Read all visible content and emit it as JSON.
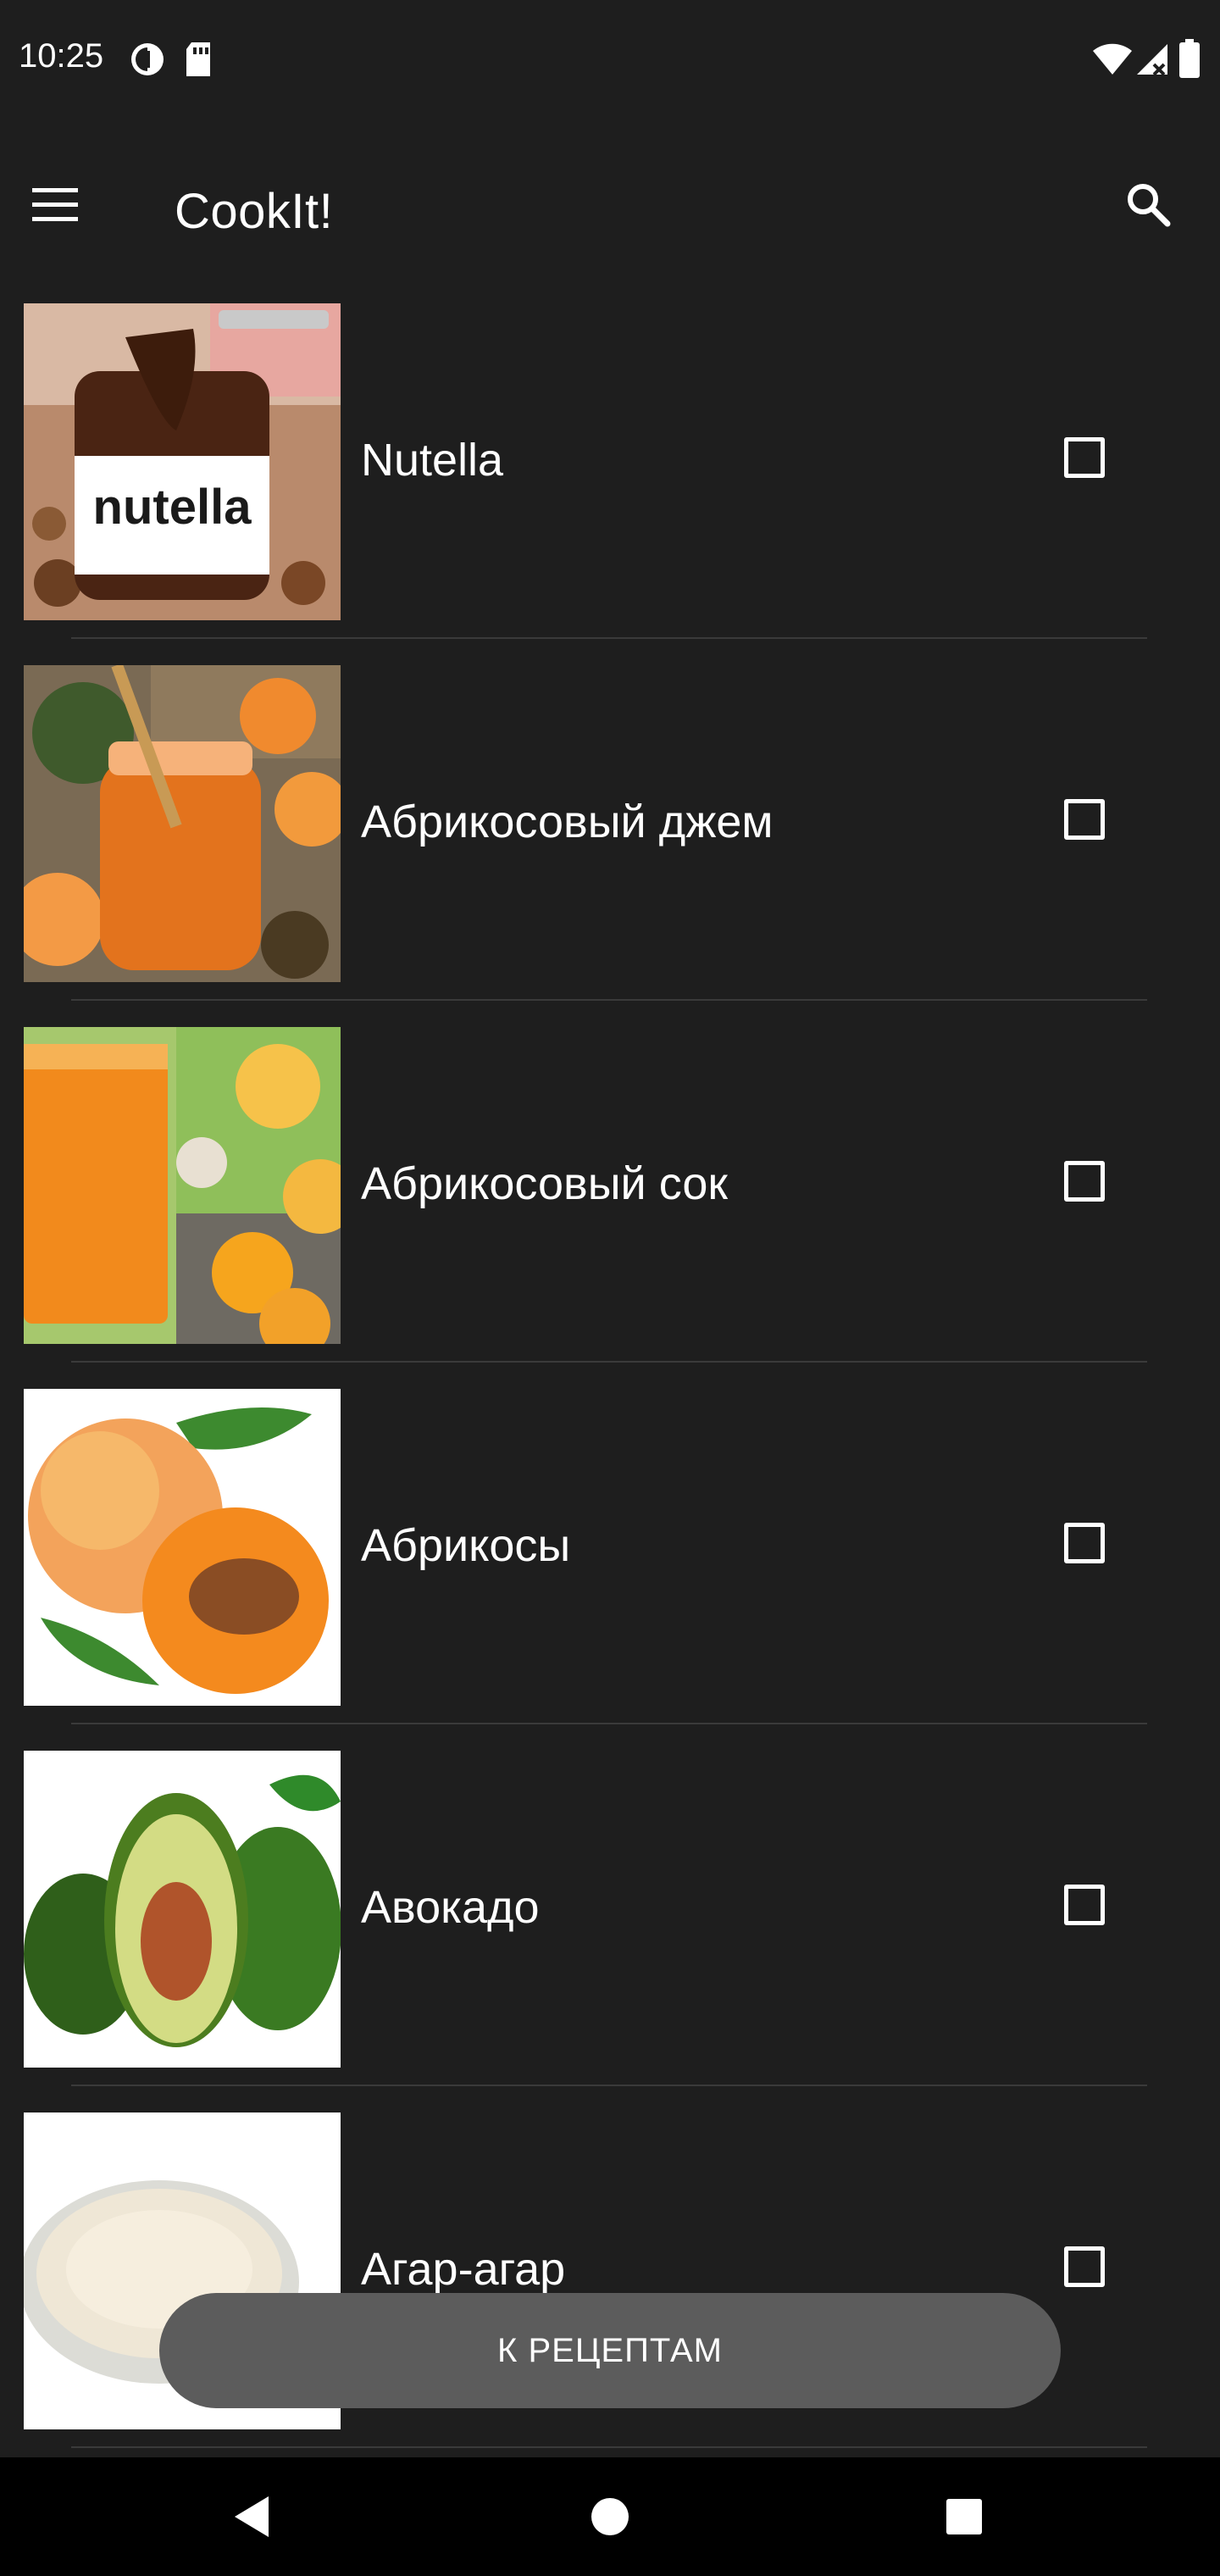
{
  "status_bar": {
    "time": "10:25",
    "icons": [
      "data-saver-icon",
      "sd-card-icon",
      "wifi-icon",
      "signal-icon",
      "battery-icon"
    ]
  },
  "app_bar": {
    "title": "CookIt!",
    "menu_icon": "menu-icon",
    "search_icon": "search-icon"
  },
  "ingredients": [
    {
      "name": "Nutella",
      "checked": false,
      "image": "nutella-jar"
    },
    {
      "name": "Абрикосовый джем",
      "checked": false,
      "image": "apricot-jam"
    },
    {
      "name": "Абрикосовый сок",
      "checked": false,
      "image": "apricot-juice"
    },
    {
      "name": "Абрикосы",
      "checked": false,
      "image": "apricots"
    },
    {
      "name": "Авокадо",
      "checked": false,
      "image": "avocado"
    },
    {
      "name": "Агар-агар",
      "checked": false,
      "image": "agar-powder"
    }
  ],
  "action_button": {
    "label": "К РЕЦЕПТАМ"
  },
  "nav_bar": {
    "icons": [
      "back-icon",
      "home-icon",
      "recents-icon"
    ]
  },
  "colors": {
    "background": "#1e1e1e",
    "text": "#ffffff",
    "button": "#5c5c5c",
    "divider": "#3a3a3a",
    "nav_bar": "#000000"
  }
}
